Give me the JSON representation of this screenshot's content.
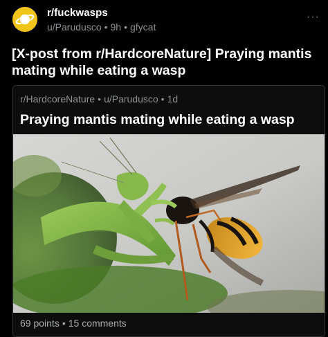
{
  "post": {
    "subreddit": "r/fuckwasps",
    "author": "u/Parudusco",
    "age": "9h",
    "domain": "gfycat",
    "title": "[X-post from r/HardcoreNature] Praying mantis mating while eating a wasp"
  },
  "crosspost": {
    "subreddit": "r/HardcoreNature",
    "author": "u/Parudusco",
    "age": "1d",
    "title": "Praying mantis mating while eating a wasp",
    "points": "69 points",
    "comments": "15 comments"
  },
  "icons": {
    "avatar": "planet-avatar-icon",
    "more": "more-options-icon"
  },
  "separator": "•",
  "more_glyph": "···",
  "colors": {
    "background": "#000000",
    "text": "#ffffff",
    "meta": "#8d9296",
    "avatar": "#f0c419"
  }
}
